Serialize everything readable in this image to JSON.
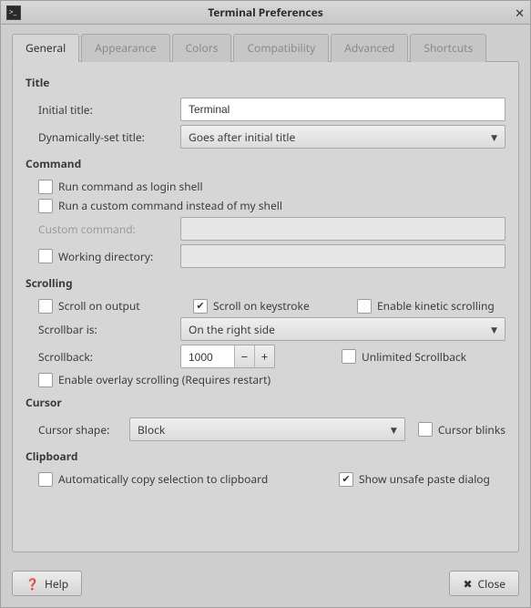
{
  "window": {
    "title": "Terminal Preferences"
  },
  "tabs": [
    "General",
    "Appearance",
    "Colors",
    "Compatibility",
    "Advanced",
    "Shortcuts"
  ],
  "active_tab": "General",
  "title_section": {
    "heading": "Title",
    "initial_title_label": "Initial title:",
    "initial_title_value": "Terminal",
    "dyn_title_label": "Dynamically-set title:",
    "dyn_title_value": "Goes after initial title"
  },
  "command_section": {
    "heading": "Command",
    "login_shell": "Run command as login shell",
    "login_shell_checked": false,
    "custom_cmd_cb": "Run a custom command instead of my shell",
    "custom_cmd_cb_checked": false,
    "custom_cmd_label": "Custom command:",
    "custom_cmd_value": "",
    "working_dir_cb": "Working directory:",
    "working_dir_cb_checked": false,
    "working_dir_value": ""
  },
  "scrolling_section": {
    "heading": "Scrolling",
    "scroll_on_output": "Scroll on output",
    "scroll_on_output_checked": false,
    "scroll_on_keystroke": "Scroll on keystroke",
    "scroll_on_keystroke_checked": true,
    "enable_kinetic": "Enable kinetic scrolling",
    "enable_kinetic_checked": false,
    "scrollbar_is_label": "Scrollbar is:",
    "scrollbar_is_value": "On the right side",
    "scrollback_label": "Scrollback:",
    "scrollback_value": "1000",
    "unlimited_scrollback": "Unlimited Scrollback",
    "unlimited_scrollback_checked": false,
    "enable_overlay": "Enable overlay scrolling (Requires restart)",
    "enable_overlay_checked": false
  },
  "cursor_section": {
    "heading": "Cursor",
    "shape_label": "Cursor shape:",
    "shape_value": "Block",
    "blinks": "Cursor blinks",
    "blinks_checked": false
  },
  "clipboard_section": {
    "heading": "Clipboard",
    "autocopy": "Automatically copy selection to clipboard",
    "autocopy_checked": false,
    "unsafe_paste": "Show unsafe paste dialog",
    "unsafe_paste_checked": true
  },
  "footer": {
    "help": "Help",
    "close": "Close"
  }
}
